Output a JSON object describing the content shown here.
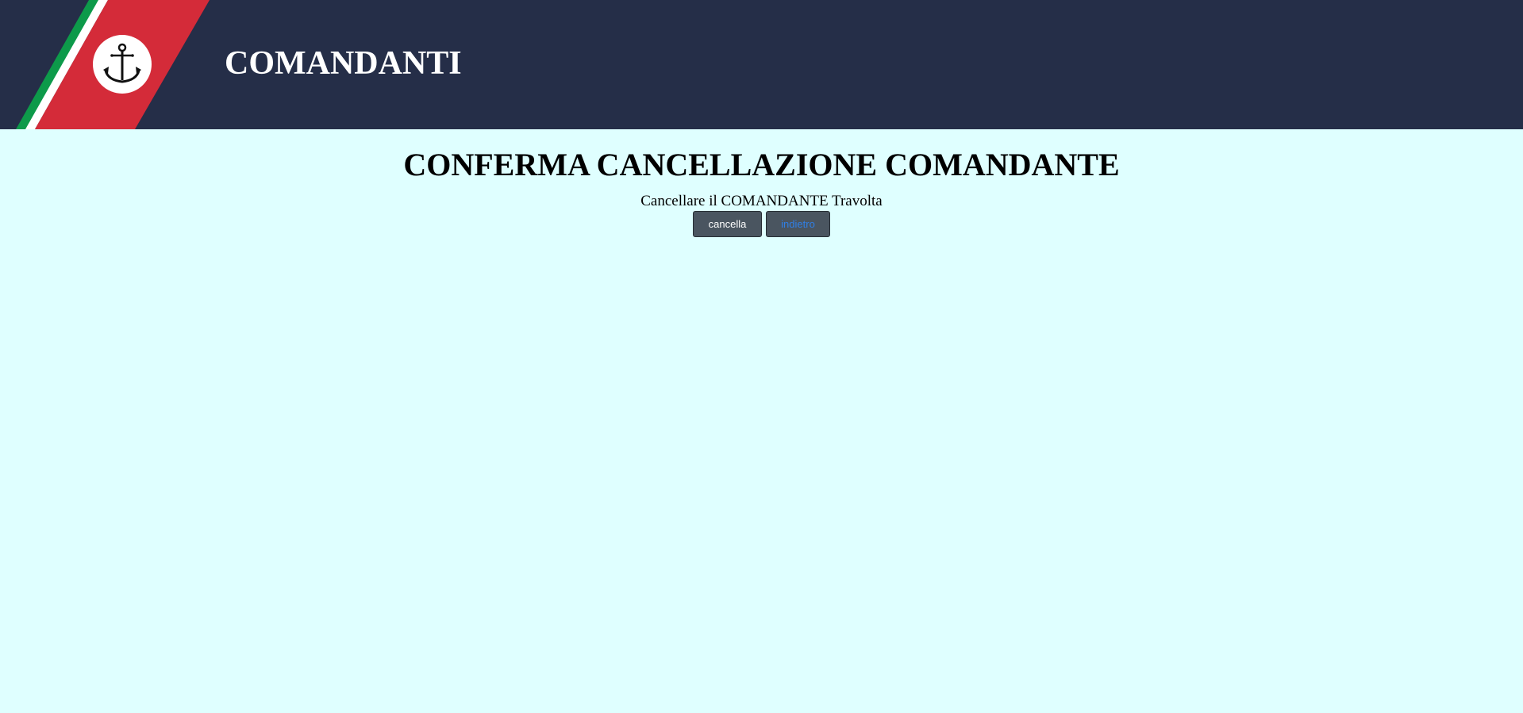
{
  "header": {
    "title": "COMANDANTI",
    "logo_icon": "anchor-icon",
    "colors": {
      "background": "#252e48",
      "stripe_green": "#0d9a4a",
      "stripe_white": "#ffffff",
      "stripe_red": "#d42b39"
    }
  },
  "page": {
    "title": "CONFERMA CANCELLAZIONE COMANDANTE",
    "message": "Cancellare il COMANDANTE Travolta",
    "background": "#dfffff"
  },
  "actions": {
    "delete_label": "cancella",
    "back_label": "indietro"
  }
}
